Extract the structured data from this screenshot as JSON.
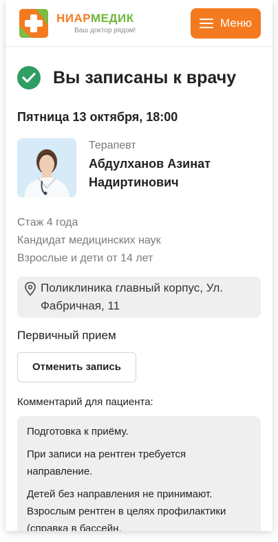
{
  "header": {
    "brand_part1": "НИАР",
    "brand_part2": "МЕДИК",
    "tagline": "Ваш доктор рядом!",
    "menu_label": "Меню",
    "colors": {
      "orange": "#f47a1f",
      "green": "#6fb63b"
    }
  },
  "status": {
    "title": "Вы записаны к врачу",
    "icon": "check-circle-icon",
    "color": "#2e9e63"
  },
  "appointment": {
    "datetime": "Пятница 13 октября, 18:00",
    "specialty": "Терапевт",
    "doctor_name": "Абдулханов Азинат Надиртинович",
    "experience": "Стаж 4 года",
    "degree": "Кандидат медицинских наук",
    "patients": "Взрослые и дети от 14 лет",
    "address": "Поликлиника главный корпус, Ул. Фабричная, 11",
    "visit_type": "Первичный прием",
    "cancel_label": "Отменить запись"
  },
  "comment": {
    "label": "Комментарий для пациента:",
    "paragraphs": [
      "Подготовка к приёму.",
      "При записи на рентген требуется направление.",
      "Детей без направления не принимают. Взрослым рентген в целях профилактики (справка в бассейн,"
    ]
  }
}
